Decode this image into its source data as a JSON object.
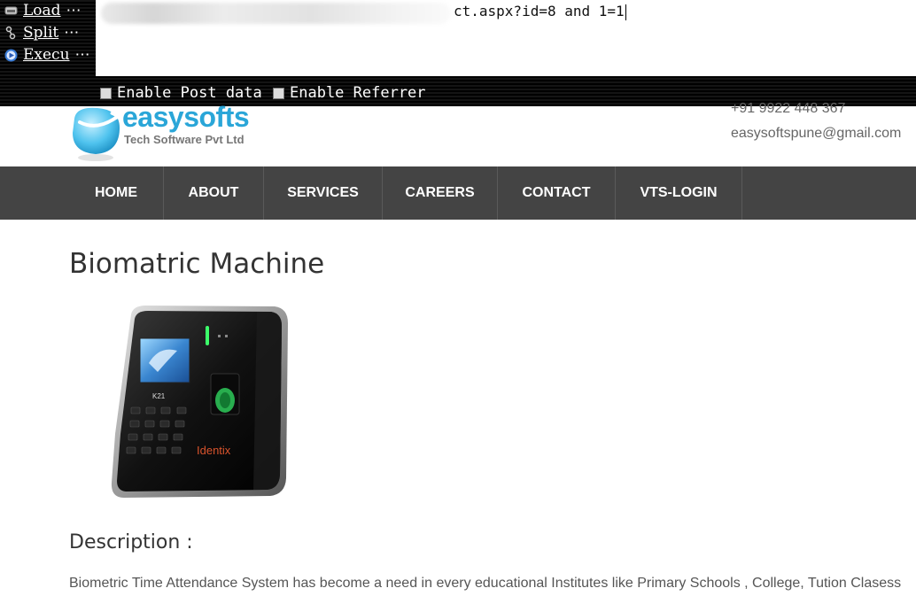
{
  "hackbar": {
    "buttons": [
      {
        "label": "Load",
        "suffix": "⋯",
        "icon": "load-url-icon"
      },
      {
        "label": "Split",
        "suffix": "⋯",
        "icon": "split-url-icon"
      },
      {
        "label": "Execu",
        "suffix": "⋯",
        "icon": "execute-icon"
      }
    ],
    "url_visible": "ct.aspx?id=8 and 1=1",
    "enable_post_label": "Enable Post data",
    "enable_referrer_label": "Enable Referrer"
  },
  "site": {
    "logo_name": "easysofts",
    "logo_tagline": "Tech Software Pvt Ltd",
    "phone": "+91 9922 448 367",
    "email": "easysoftspune@gmail.com",
    "nav": [
      "HOME",
      "ABOUT",
      "SERVICES",
      "CAREERS",
      "CONTACT",
      "VTS-LOGIN"
    ],
    "brand_color": "#2aa6d8",
    "nav_bg": "#444444"
  },
  "content": {
    "title": "Biomatric Machine",
    "product_model": "K21",
    "product_brand": "Identix",
    "description_heading": "Description :",
    "description_text": "Biometric Time Attendance System has become a need in every educational Institutes like Primary Schools , College, Tution Clasess"
  }
}
